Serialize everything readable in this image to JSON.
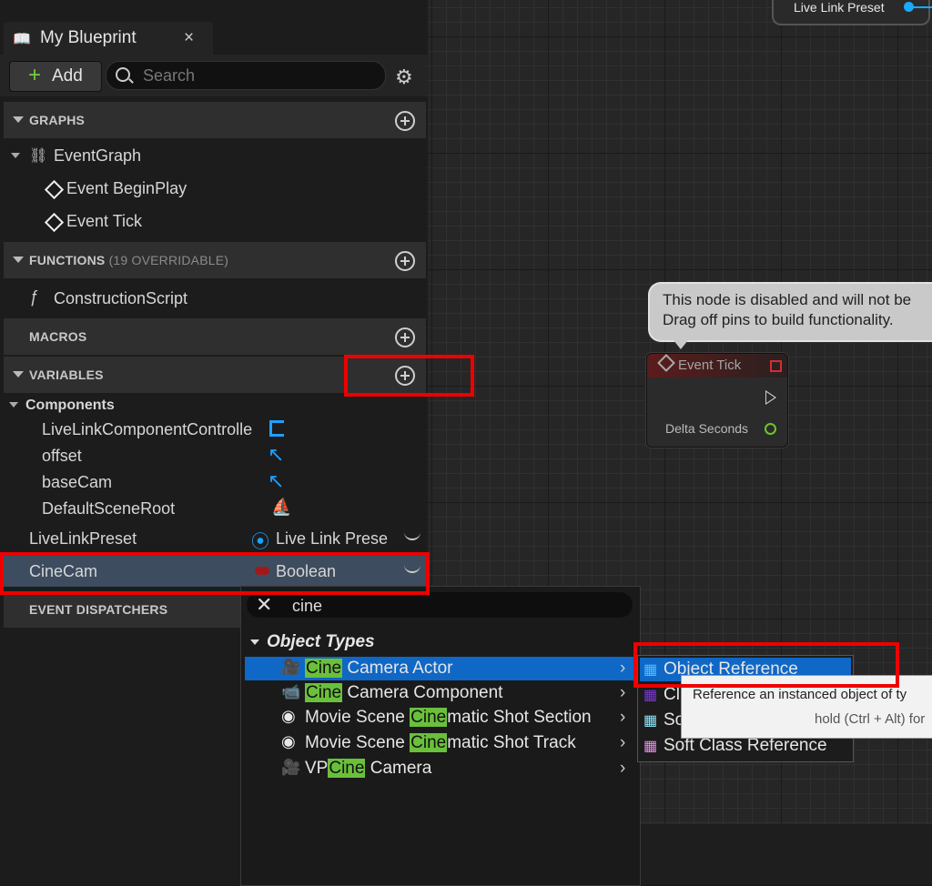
{
  "graph": {
    "top_node_label": "Live Link Preset",
    "comment_line1": "This node is disabled and will not be",
    "comment_line2": "Drag off pins to build functionality.",
    "event_node_title": "Event Tick",
    "event_node_pin": "Delta Seconds"
  },
  "panel": {
    "tab_title": "My Blueprint",
    "tab_close": "×",
    "add_label": "Add",
    "search_placeholder": "Search"
  },
  "sections": {
    "graphs": "GRAPHS",
    "functions": "FUNCTIONS",
    "functions_note": "(19 OVERRIDABLE)",
    "macros": "MACROS",
    "variables": "VARIABLES",
    "event_dispatchers": "EVENT DISPATCHERS"
  },
  "graphs": {
    "event_graph": "EventGraph",
    "events": [
      "Event BeginPlay",
      "Event Tick"
    ]
  },
  "functions": {
    "construction": "ConstructionScript"
  },
  "variables": {
    "components_label": "Components",
    "components": [
      "LiveLinkComponentControlle",
      "offset",
      "baseCam",
      "DefaultSceneRoot"
    ],
    "items": [
      {
        "name": "LiveLinkPreset",
        "type": "Live Link Prese"
      },
      {
        "name": "CineCam",
        "type": "Boolean"
      }
    ]
  },
  "menu": {
    "search_value": "cine",
    "clear_icon": "✕",
    "category": "Object Types",
    "items": [
      {
        "pre": "",
        "hit": "Cine",
        "post": " Camera Actor"
      },
      {
        "pre": "",
        "hit": "Cine",
        "post": " Camera Component"
      },
      {
        "pre": "Movie Scene ",
        "hit": "Cine",
        "post": "matic Shot Section"
      },
      {
        "pre": "Movie Scene ",
        "hit": "Cine",
        "post": "matic Shot Track"
      },
      {
        "pre": "VP",
        "hit": "Cine",
        "post": " Camera"
      }
    ],
    "chevron": "›"
  },
  "submenu": {
    "items": [
      "Object Reference",
      "Cl",
      "So",
      "Soft Class Reference"
    ]
  },
  "tooltip": {
    "line1": "Reference an instanced object of ty",
    "line2": "hold (Ctrl + Alt) for"
  },
  "colors": {
    "highlight": "#0f67c6",
    "match": "#6ac03b",
    "annotation": "#ee0000",
    "selected_row": "#3d4c5e"
  }
}
